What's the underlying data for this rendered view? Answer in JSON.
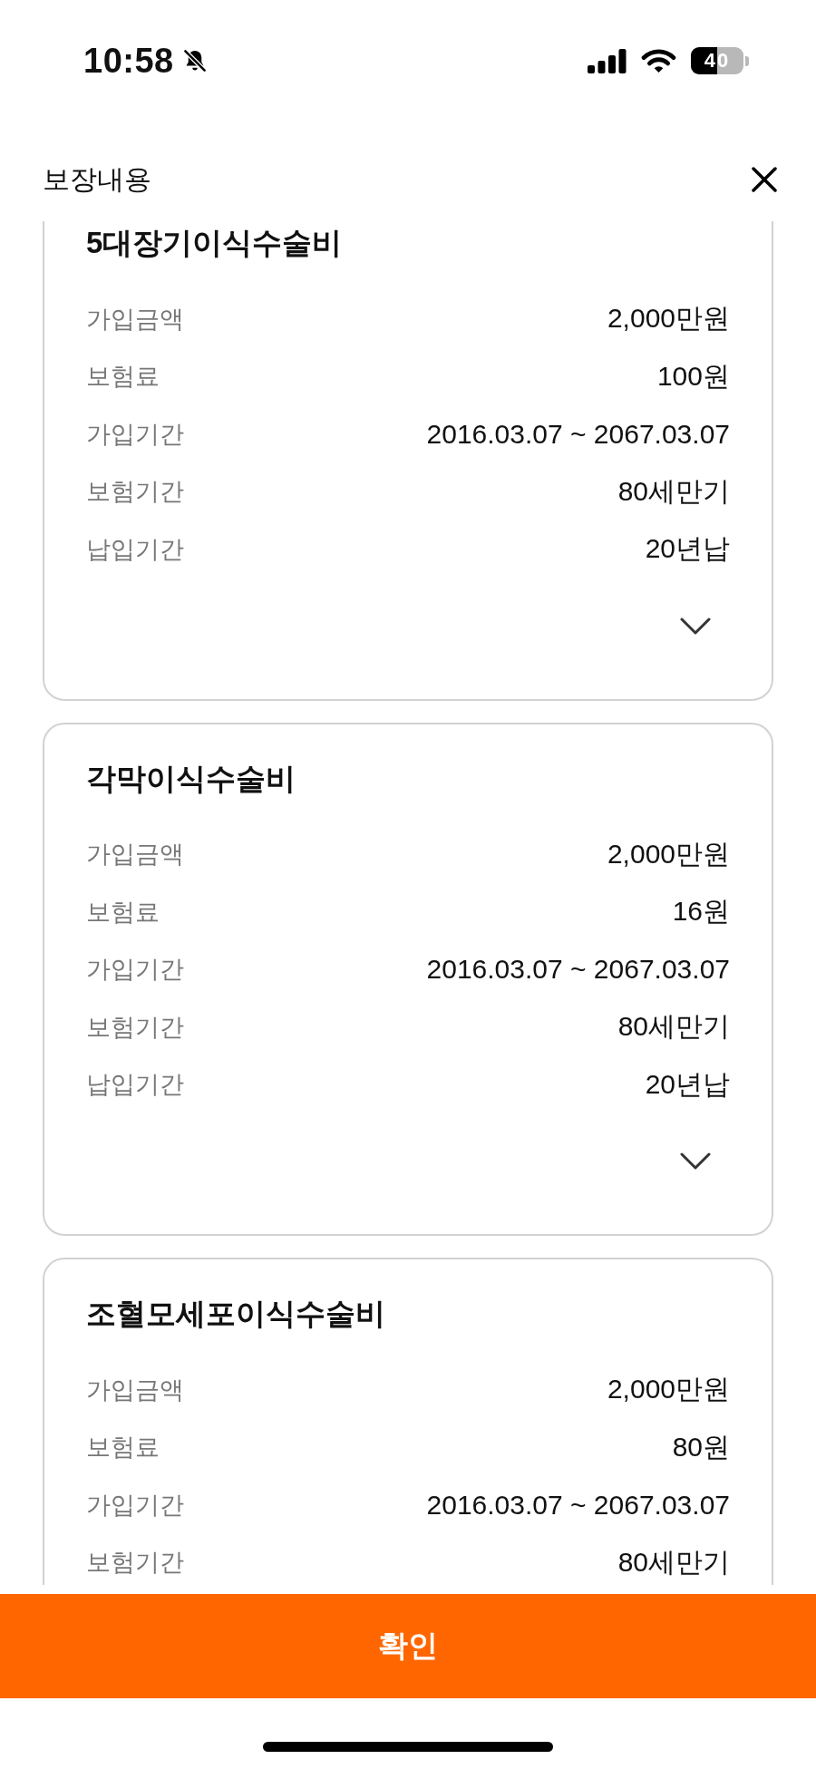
{
  "status_bar": {
    "time": "10:58",
    "battery": "40"
  },
  "header": {
    "title": "보장내용"
  },
  "coverages": [
    {
      "title": "5대장기이식수술비",
      "expanded": false,
      "rows": [
        {
          "label": "가입금액",
          "value": "2,000만원"
        },
        {
          "label": "보험료",
          "value": "100원"
        },
        {
          "label": "가입기간",
          "value": "2016.03.07 ~ 2067.03.07"
        },
        {
          "label": "보험기간",
          "value": "80세만기"
        },
        {
          "label": "납입기간",
          "value": "20년납"
        }
      ]
    },
    {
      "title": "각막이식수술비",
      "expanded": false,
      "rows": [
        {
          "label": "가입금액",
          "value": "2,000만원"
        },
        {
          "label": "보험료",
          "value": "16원"
        },
        {
          "label": "가입기간",
          "value": "2016.03.07 ~ 2067.03.07"
        },
        {
          "label": "보험기간",
          "value": "80세만기"
        },
        {
          "label": "납입기간",
          "value": "20년납"
        }
      ]
    },
    {
      "title": "조혈모세포이식수술비",
      "rows": [
        {
          "label": "가입금액",
          "value": "2,000만원"
        },
        {
          "label": "보험료",
          "value": "80원"
        },
        {
          "label": "가입기간",
          "value": "2016.03.07 ~ 2067.03.07"
        },
        {
          "label": "보험기간",
          "value": "80세만기"
        }
      ]
    }
  ],
  "confirm_button": {
    "label": "확인"
  }
}
